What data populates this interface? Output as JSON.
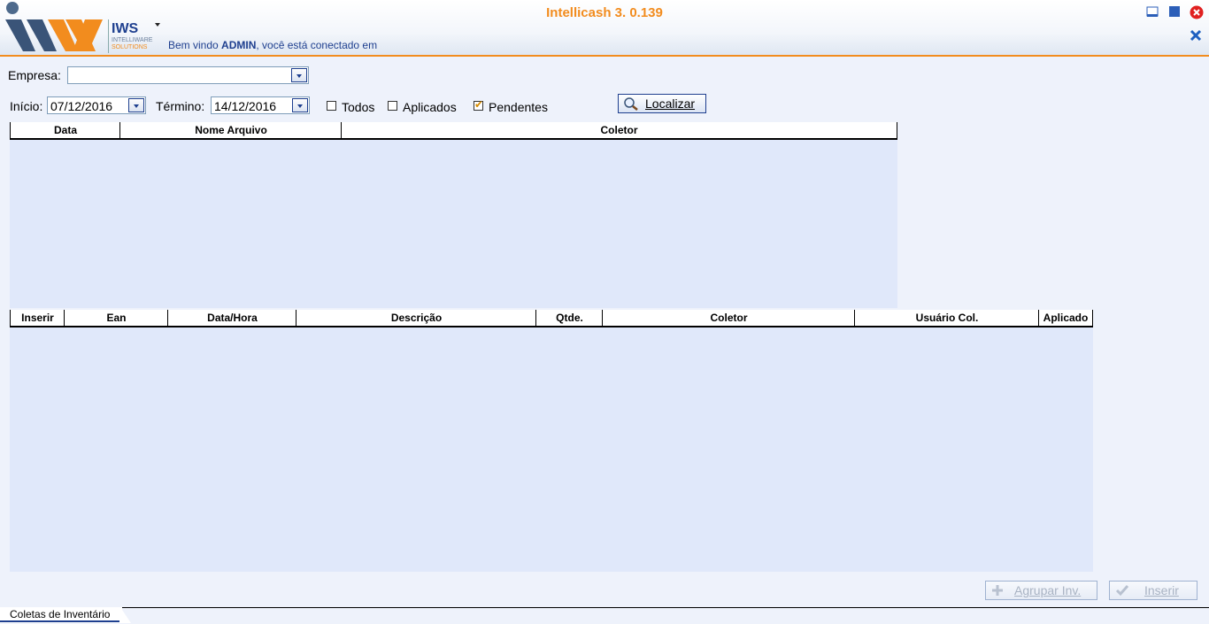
{
  "header": {
    "app_title": "Intellicash 3. 0.139",
    "brand_name": "IWS",
    "brand_sub1": "INTELLIWARE",
    "brand_sub2": "SOLUTIONS",
    "welcome_prefix": "Bem vindo ",
    "welcome_user": "ADMIN",
    "welcome_suffix": ", você está conectado em"
  },
  "filters": {
    "empresa_label": "Empresa:",
    "empresa_value": "",
    "inicio_label": "Início:",
    "inicio_value": "07/12/2016",
    "termino_label": "Término:",
    "termino_value": "14/12/2016",
    "checkboxes": [
      {
        "label": "Todos",
        "checked": false
      },
      {
        "label": "Aplicados",
        "checked": false
      },
      {
        "label": "Pendentes",
        "checked": true
      }
    ],
    "localizar_label": "Localizar"
  },
  "files_grid": {
    "columns": [
      "Data",
      "Nome Arquivo",
      "Coletor"
    ],
    "rows": []
  },
  "items_grid": {
    "columns": [
      "Inserir",
      "Ean",
      "Data/Hora",
      "Descrição",
      "Qtde.",
      "Coletor",
      "Usuário Col.",
      "Aplicado"
    ],
    "rows": []
  },
  "actions": {
    "agrupar_label": "Agrupar Inv.",
    "inserir_label": "Inserir"
  },
  "tabs": [
    {
      "label": "Coletas de Inventário",
      "active": true
    }
  ],
  "colors": {
    "accent_orange": "#f28c1e",
    "brand_blue": "#1e3f8f",
    "grid_background": "#e0e8fa",
    "close_red": "#e02020"
  },
  "icons": [
    "window-menu-icon",
    "restore-icon",
    "close-circle-icon",
    "close-x-icon",
    "magnifier-icon",
    "plus-icon",
    "checkmark-icon",
    "chevron-down-icon"
  ]
}
